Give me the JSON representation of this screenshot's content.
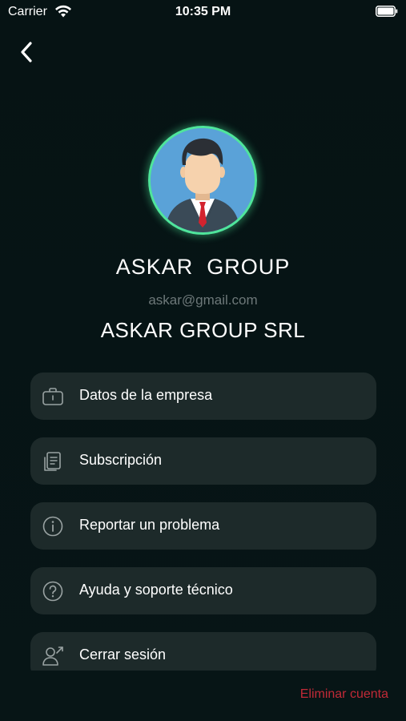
{
  "status_bar": {
    "carrier": "Carrier",
    "time": "10:35 PM"
  },
  "profile": {
    "name": "ASKAR  GROUP",
    "email": "askar@gmail.com",
    "company": "ASKAR GROUP SRL"
  },
  "menu": {
    "items": [
      {
        "label": "Datos de la empresa",
        "icon": "briefcase-icon"
      },
      {
        "label": "Subscripción",
        "icon": "document-icon"
      },
      {
        "label": "Reportar un problema",
        "icon": "info-icon"
      },
      {
        "label": "Ayuda y soporte técnico",
        "icon": "help-icon"
      },
      {
        "label": "Cerrar sesión",
        "icon": "logout-user-icon"
      }
    ]
  },
  "footer": {
    "delete_account": "Eliminar cuenta"
  },
  "colors": {
    "background": "#061314",
    "card": "#1d2a2a",
    "avatar_ring": "#4fe59b",
    "danger": "#c22a37",
    "muted_text": "#6d7879"
  }
}
